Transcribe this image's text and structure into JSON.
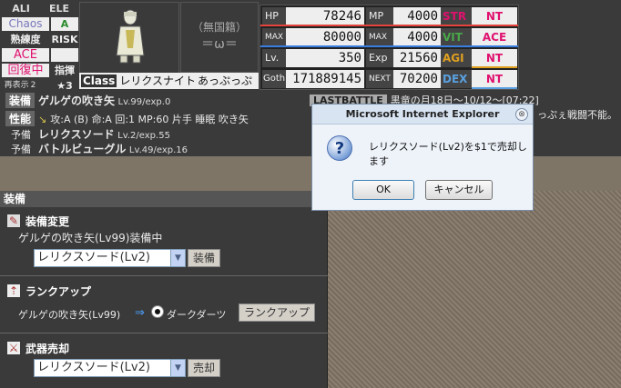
{
  "left_grid": {
    "ali": "ALI",
    "ele": "ELE",
    "chaos": "Chaos",
    "ele_icon": "A",
    "proficiency": "熟練度",
    "risk": "RISK",
    "ace": "ACE",
    "recovering": "回復中",
    "command": "指揮",
    "redisplay": "再表示",
    "redisplay_num": "2",
    "stars": "★3"
  },
  "nation": {
    "label": "（無国籍）",
    "symbol": "＝ω＝"
  },
  "class_row": {
    "label": "Class",
    "class_name": "レリクスナイト",
    "name": "あっぷっぷぇ"
  },
  "stats": {
    "hp_label": "HP",
    "hp": "78246",
    "mp_label": "MP",
    "mp": "4000",
    "max_label": "MAX",
    "max_hp": "80000",
    "max_label2": "MAX",
    "max_mp": "4000",
    "lv_label": "Lv.",
    "lv": "350",
    "exp_label": "Exp",
    "exp": "21560",
    "goth_label": "Goth",
    "goth": "171889145",
    "next_label": "NEXT",
    "next": "70200",
    "str_label": "STR",
    "str": "NT",
    "vit_label": "VIT",
    "vit": "ACE",
    "agi_label": "AGI",
    "agi": "NT",
    "dex_label": "DEX",
    "dex": "NT"
  },
  "info": {
    "equip_tag": "装備",
    "weapon": "ゲルゲの吹き矢",
    "weapon_lv": "Lv.99/exp.0",
    "last_battle": "LASTBATTLE",
    "last_battle_text": "黒竜の月18日～10/12～[07:22]",
    "last_battle_text2": "っぷぇ戦闘不能。",
    "perf_tag": "性能",
    "perf_text": "攻:A (B) 命:A 回:1 MP:60 片手 睡眠 吹き矢",
    "spare1_label": "予備",
    "spare1": "レリクスソード",
    "spare1_lv": "Lv.2/exp.55",
    "spare2_label": "予備",
    "spare2": "バトルビューグル",
    "spare2_lv": "Lv.49/exp.16"
  },
  "equip_panel": {
    "header": "装備",
    "change_title": "装備変更",
    "change_status": "ゲルゲの吹き矢(Lv99)装備中",
    "change_select": "レリクスソード(Lv2)",
    "equip_button": "装備",
    "rankup_title": "ランクアップ",
    "rankup_from": "ゲルゲの吹き矢(Lv99)",
    "rankup_arrow": "⇒",
    "rankup_to": "ダークダーツ",
    "rankup_button": "ランクアップ",
    "sell_title": "武器売却",
    "sell_select": "レリクスソード(Lv2)",
    "sell_button": "売却"
  },
  "dialog": {
    "title": "Microsoft Internet Explorer",
    "close": "⊗",
    "message": "レリクスソード(Lv2)を$1で売却します",
    "ok": "OK",
    "cancel": "キャンセル"
  },
  "colors": {
    "str": "#e0116f",
    "vit": "#e0116f",
    "nt": "#e0116f",
    "hp_bar": "#e4433b",
    "mp_bar": "#3a7de0"
  }
}
